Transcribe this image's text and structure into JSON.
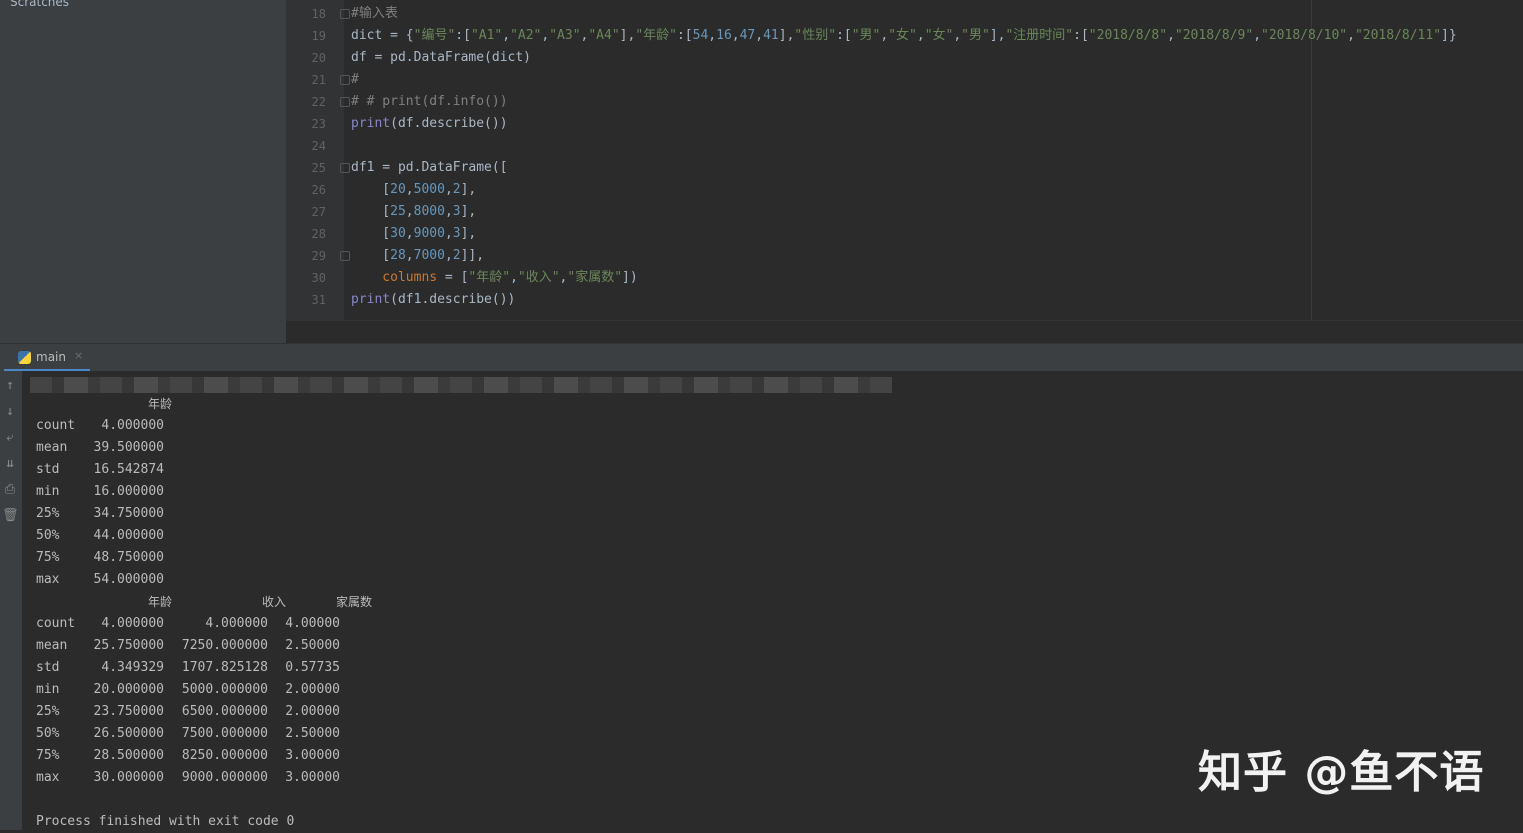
{
  "sidebar": {
    "scratches_label": "Scratches"
  },
  "editor": {
    "lines": [
      {
        "num": "18",
        "parts": [
          [
            "cm",
            "#输入表"
          ]
        ]
      },
      {
        "num": "19",
        "parts": [
          [
            "plain",
            "dict = {"
          ],
          [
            "str",
            "\"编号\""
          ],
          [
            "plain",
            ":["
          ],
          [
            "str",
            "\"A1\""
          ],
          [
            "plain",
            ","
          ],
          [
            "str",
            "\"A2\""
          ],
          [
            "plain",
            ","
          ],
          [
            "str",
            "\"A3\""
          ],
          [
            "plain",
            ","
          ],
          [
            "str",
            "\"A4\""
          ],
          [
            "plain",
            "],"
          ],
          [
            "str",
            "\"年龄\""
          ],
          [
            "plain",
            ":["
          ],
          [
            "num",
            "54"
          ],
          [
            "plain",
            ","
          ],
          [
            "num",
            "16"
          ],
          [
            "plain",
            ","
          ],
          [
            "num",
            "47"
          ],
          [
            "plain",
            ","
          ],
          [
            "num",
            "41"
          ],
          [
            "plain",
            "],"
          ],
          [
            "str",
            "\"性别\""
          ],
          [
            "plain",
            ":["
          ],
          [
            "str",
            "\"男\""
          ],
          [
            "plain",
            ","
          ],
          [
            "str",
            "\"女\""
          ],
          [
            "plain",
            ","
          ],
          [
            "str",
            "\"女\""
          ],
          [
            "plain",
            ","
          ],
          [
            "str",
            "\"男\""
          ],
          [
            "plain",
            "],"
          ],
          [
            "str",
            "\"注册时间\""
          ],
          [
            "plain",
            ":["
          ],
          [
            "str",
            "\"2018/8/8\""
          ],
          [
            "plain",
            ","
          ],
          [
            "str",
            "\"2018/8/9\""
          ],
          [
            "plain",
            ","
          ],
          [
            "str",
            "\"2018/8/10\""
          ],
          [
            "plain",
            ","
          ],
          [
            "str",
            "\"2018/8/11\""
          ],
          [
            "plain",
            "]}"
          ]
        ]
      },
      {
        "num": "20",
        "parts": [
          [
            "plain",
            "df = pd.DataFrame(dict)"
          ]
        ]
      },
      {
        "num": "21",
        "parts": [
          [
            "cm",
            "#"
          ]
        ]
      },
      {
        "num": "22",
        "parts": [
          [
            "cm",
            "# # print(df.info())"
          ]
        ]
      },
      {
        "num": "23",
        "parts": [
          [
            "fn",
            "print"
          ],
          [
            "plain",
            "(df.describe())"
          ]
        ]
      },
      {
        "num": "24",
        "parts": []
      },
      {
        "num": "25",
        "parts": [
          [
            "plain",
            "df1 = pd.DataFrame(["
          ]
        ]
      },
      {
        "num": "26",
        "parts": [
          [
            "plain",
            "    ["
          ],
          [
            "num",
            "20"
          ],
          [
            "plain",
            ","
          ],
          [
            "num",
            "5000"
          ],
          [
            "plain",
            ","
          ],
          [
            "num",
            "2"
          ],
          [
            "plain",
            "],"
          ]
        ]
      },
      {
        "num": "27",
        "parts": [
          [
            "plain",
            "    ["
          ],
          [
            "num",
            "25"
          ],
          [
            "plain",
            ","
          ],
          [
            "num",
            "8000"
          ],
          [
            "plain",
            ","
          ],
          [
            "num",
            "3"
          ],
          [
            "plain",
            "],"
          ]
        ]
      },
      {
        "num": "28",
        "parts": [
          [
            "plain",
            "    ["
          ],
          [
            "num",
            "30"
          ],
          [
            "plain",
            ","
          ],
          [
            "num",
            "9000"
          ],
          [
            "plain",
            ","
          ],
          [
            "num",
            "3"
          ],
          [
            "plain",
            "],"
          ]
        ]
      },
      {
        "num": "29",
        "parts": [
          [
            "plain",
            "    ["
          ],
          [
            "num",
            "28"
          ],
          [
            "plain",
            ","
          ],
          [
            "num",
            "7000"
          ],
          [
            "plain",
            ","
          ],
          [
            "num",
            "2"
          ],
          [
            "plain",
            "]],"
          ]
        ]
      },
      {
        "num": "30",
        "parts": [
          [
            "kw",
            "    columns"
          ],
          [
            "plain",
            " = ["
          ],
          [
            "str",
            "\"年龄\""
          ],
          [
            "plain",
            ","
          ],
          [
            "str",
            "\"收入\""
          ],
          [
            "plain",
            ","
          ],
          [
            "str",
            "\"家属数\""
          ],
          [
            "plain",
            "])"
          ]
        ]
      },
      {
        "num": "31",
        "parts": [
          [
            "fn",
            "print"
          ],
          [
            "plain",
            "(df1.describe())"
          ]
        ]
      }
    ]
  },
  "run_tab": {
    "label": "main",
    "close": "×"
  },
  "toolbar": {
    "up": "↑",
    "down": "↓",
    "wrap": "⤶",
    "scroll_end": "⇊",
    "print": "⎙",
    "clear": "🗑"
  },
  "console": {
    "table1": {
      "header": "年龄",
      "rows": [
        {
          "stat": "count",
          "v1": "4.000000"
        },
        {
          "stat": "mean",
          "v1": "39.500000"
        },
        {
          "stat": "std",
          "v1": "16.542874"
        },
        {
          "stat": "min",
          "v1": "16.000000"
        },
        {
          "stat": "25%",
          "v1": "34.750000"
        },
        {
          "stat": "50%",
          "v1": "44.000000"
        },
        {
          "stat": "75%",
          "v1": "48.750000"
        },
        {
          "stat": "max",
          "v1": "54.000000"
        }
      ]
    },
    "table2": {
      "headers": [
        "年龄",
        "收入",
        "家属数"
      ],
      "rows": [
        {
          "stat": "count",
          "v1": "4.000000",
          "v2": "4.000000",
          "v3": "4.00000"
        },
        {
          "stat": "mean",
          "v1": "25.750000",
          "v2": "7250.000000",
          "v3": "2.50000"
        },
        {
          "stat": "std",
          "v1": "4.349329",
          "v2": "1707.825128",
          "v3": "0.57735"
        },
        {
          "stat": "min",
          "v1": "20.000000",
          "v2": "5000.000000",
          "v3": "2.00000"
        },
        {
          "stat": "25%",
          "v1": "23.750000",
          "v2": "6500.000000",
          "v3": "2.00000"
        },
        {
          "stat": "50%",
          "v1": "26.500000",
          "v2": "7500.000000",
          "v3": "2.50000"
        },
        {
          "stat": "75%",
          "v1": "28.500000",
          "v2": "8250.000000",
          "v3": "3.00000"
        },
        {
          "stat": "max",
          "v1": "30.000000",
          "v2": "9000.000000",
          "v3": "3.00000"
        }
      ]
    },
    "exit_message": "Process finished with exit code 0"
  },
  "watermark": "知乎 @鱼不语"
}
